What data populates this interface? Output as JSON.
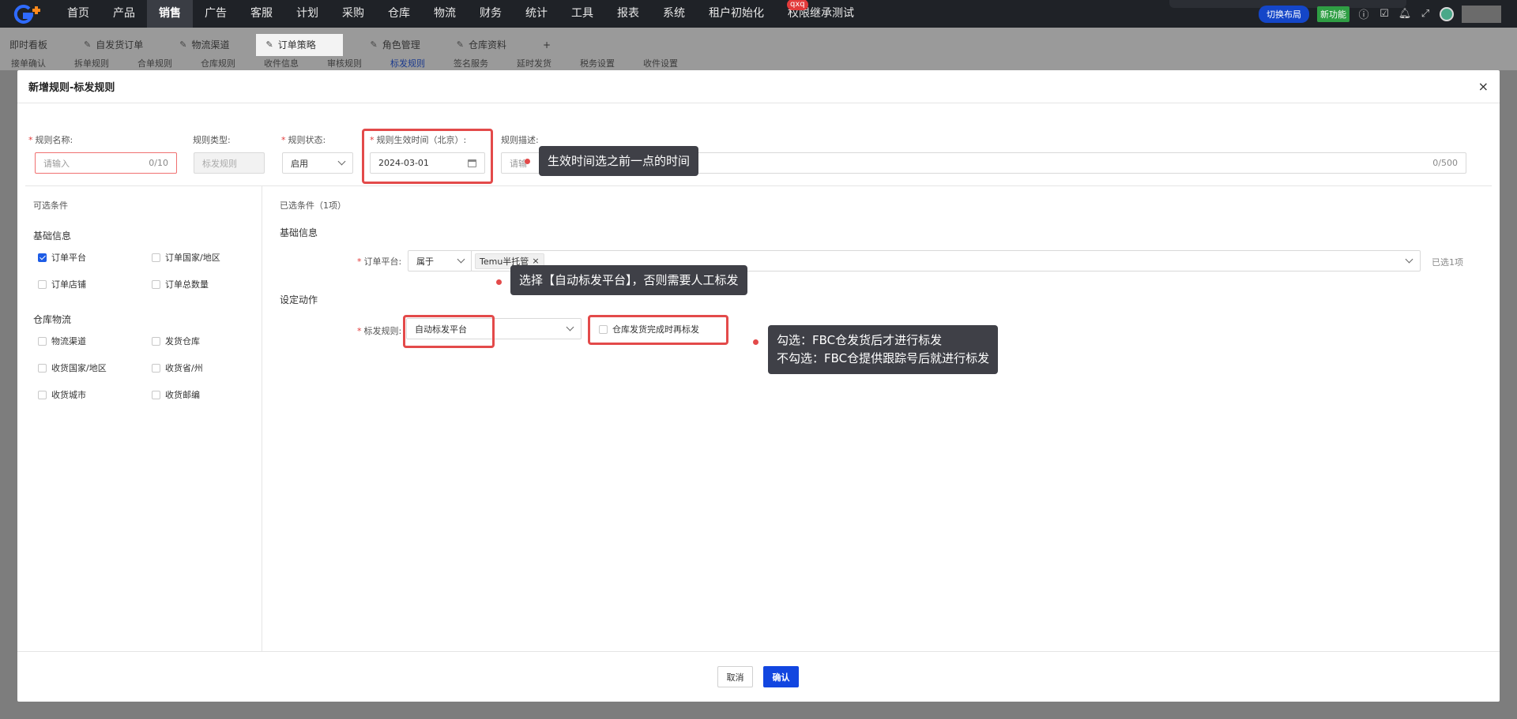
{
  "topnav": {
    "items": [
      "首页",
      "产品",
      "销售",
      "广告",
      "客服",
      "计划",
      "采购",
      "仓库",
      "物流",
      "财务",
      "统计",
      "工具",
      "报表",
      "系统",
      "租户初始化",
      "权限继承测试"
    ],
    "active_index": 2,
    "badge": "qxq",
    "switch_layout": "切换布局",
    "new_feature": "新功能"
  },
  "tabs": [
    {
      "label": "即时看板",
      "pinned": false
    },
    {
      "label": "自发货订单",
      "pinned": true
    },
    {
      "label": "物流渠道",
      "pinned": true
    },
    {
      "label": "订单策略",
      "pinned": true
    },
    {
      "label": "角色管理",
      "pinned": true
    },
    {
      "label": "仓库资料",
      "pinned": true
    }
  ],
  "tabs_add": "+",
  "subtabs": [
    "接单确认",
    "拆单规则",
    "合单规则",
    "仓库规则",
    "收件信息",
    "审核规则",
    "标发规则",
    "签名服务",
    "延时发货",
    "税务设置",
    "收件设置"
  ],
  "modal": {
    "title": "新增规则-标发规则",
    "close": "×",
    "form": {
      "name_label": "规则名称:",
      "name_placeholder": "请输入",
      "name_count": "0/10",
      "type_label": "规则类型:",
      "type_value": "标发规则",
      "status_label": "规则状态:",
      "status_value": "启用",
      "effective_label": "规则生效时间（北京）:",
      "effective_value": "2024-03-01",
      "desc_label": "规则描述:",
      "desc_placeholder": "请输",
      "desc_count": "0/500"
    },
    "left": {
      "title": "可选条件",
      "groups": [
        {
          "title": "基础信息",
          "items": [
            {
              "label": "订单平台",
              "checked": true
            },
            {
              "label": "订单国家/地区",
              "checked": false
            },
            {
              "label": "订单店铺",
              "checked": false
            },
            {
              "label": "订单总数量",
              "checked": false
            }
          ]
        },
        {
          "title": "仓库物流",
          "items": [
            {
              "label": "物流渠道",
              "checked": false
            },
            {
              "label": "发货仓库",
              "checked": false
            },
            {
              "label": "收货国家/地区",
              "checked": false
            },
            {
              "label": "收货省/州",
              "checked": false
            },
            {
              "label": "收货城市",
              "checked": false
            },
            {
              "label": "收货邮编",
              "checked": false
            }
          ]
        }
      ]
    },
    "right": {
      "selected_title": "已选条件（1项）",
      "basic_title": "基础信息",
      "platform_label": "订单平台:",
      "platform_op": "属于",
      "platform_tag": "Temu半托管",
      "platform_count": "已选1项",
      "action_title": "设定动作",
      "mark_label": "标发规则:",
      "mark_value": "自动标发平台",
      "mark_checkbox": "仓库发货完成时再标发"
    },
    "footer": {
      "cancel": "取消",
      "ok": "确认"
    }
  },
  "annotations": {
    "tip1": "生效时间选之前一点的时间",
    "tip2": "选择【自动标发平台】，否则需要人工标发",
    "tip3_line1": "勾选：FBC仓发货后才进行标发",
    "tip3_line2": "不勾选：FBC仓提供跟踪号后就进行标发"
  },
  "colors": {
    "accent": "#1246e0",
    "highlight": "#e34a4a",
    "tooltip_bg": "#3f4047",
    "nav_bg": "#1f2227"
  }
}
